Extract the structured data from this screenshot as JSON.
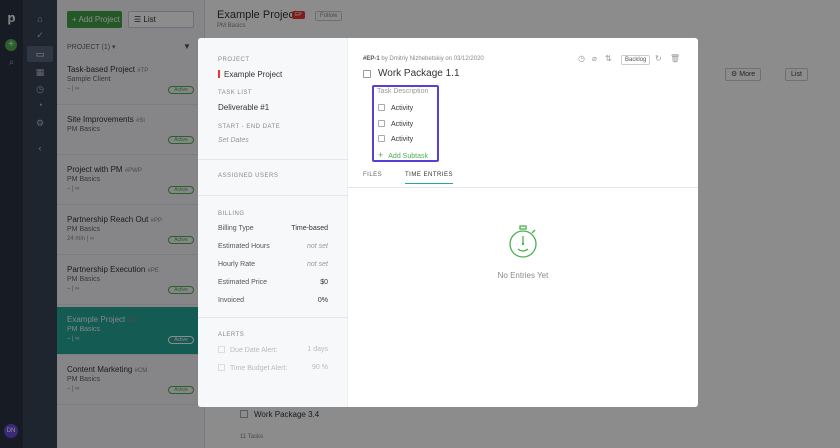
{
  "app": {
    "logo": "p",
    "avatar_initials": "DN"
  },
  "left_panel": {
    "add_button": "Add Project",
    "view_select": "List",
    "projects_header": "PROJECT (1) ▾",
    "projects": [
      {
        "name": "Task-based Project",
        "code": "#TP",
        "client": "Sample Client",
        "meta": "– | ∞",
        "status": "Active",
        "selected": false
      },
      {
        "name": "Site Improvements",
        "code": "#SI",
        "client": "PM Basics",
        "meta": "",
        "status": "Active",
        "selected": false
      },
      {
        "name": "Project with PM",
        "code": "#PWP",
        "client": "PM Basics",
        "meta": "– | ∞",
        "status": "Active",
        "selected": false
      },
      {
        "name": "Partnership Reach Out",
        "code": "#PP",
        "client": "PM Basics",
        "meta": "24 min | ∞",
        "status": "Active",
        "selected": false
      },
      {
        "name": "Partnership Execution",
        "code": "#PE",
        "client": "PM Basics",
        "meta": "– | ∞",
        "status": "Active",
        "selected": false
      },
      {
        "name": "Example Project",
        "code": "#EP",
        "client": "PM Basics",
        "meta": "– | ∞",
        "status": "Active",
        "selected": true
      },
      {
        "name": "Content Marketing",
        "code": "#CM",
        "client": "PM Basics",
        "meta": "– | ∞",
        "status": "Active",
        "selected": false
      }
    ]
  },
  "main": {
    "title": "Example Project",
    "tag": "EP",
    "follow": "Follow",
    "subtitle": "PM Basics",
    "more_button": "More",
    "list_button": "List",
    "bottom_item": "Work Package 3.4",
    "tasks_count": "11 Tasks"
  },
  "modal": {
    "project_label": "PROJECT",
    "project_value": "Example Project",
    "tasklist_label": "TASK LIST",
    "tasklist_value": "Deliverable #1",
    "dates_label": "START - END DATE",
    "dates_value": "Set Dates",
    "assigned_label": "ASSIGNED USERS",
    "billing_label": "BILLING",
    "billing": [
      {
        "label": "Billing Type",
        "value": "Time-based",
        "italic": false
      },
      {
        "label": "Estimated Hours",
        "value": "not set",
        "italic": true
      },
      {
        "label": "Hourly Rate",
        "value": "not set",
        "italic": true
      },
      {
        "label": "Estimated Price",
        "value": "$0",
        "italic": false
      },
      {
        "label": "Invoiced",
        "value": "0%",
        "italic": false
      }
    ],
    "alerts_label": "ALERTS",
    "alerts": [
      {
        "label": "Due Date Alert:",
        "value": "1 days"
      },
      {
        "label": "Time Budget Alert:",
        "value": "90 %"
      }
    ],
    "task_id": "#EP-1",
    "task_author": "by Dmitriy Nizhebetskiy on 03/12/2020",
    "status": "Backlog",
    "task_title": "Work Package 1.1",
    "description_placeholder": "Task Description",
    "subtasks": [
      "Activity",
      "Activity",
      "Activity"
    ],
    "add_subtask": "Add Subtask",
    "tabs": [
      {
        "label": "FILES",
        "active": false
      },
      {
        "label": "TIME ENTRIES",
        "active": true
      }
    ],
    "empty_text": "No Entries Yet"
  },
  "colors": {
    "accent_green": "#4caf50",
    "highlight_purple": "#5b3fd0",
    "selected_teal": "#26a69a"
  }
}
